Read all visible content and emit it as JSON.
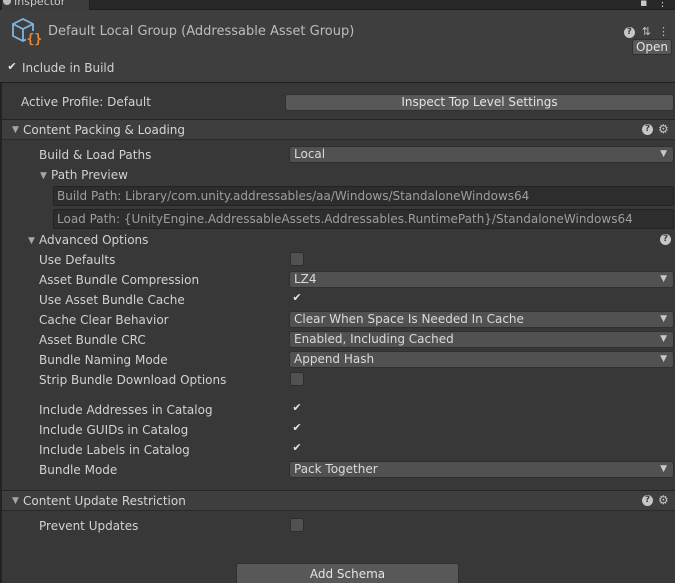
{
  "tab": {
    "label": "Inspector"
  },
  "header": {
    "title": "Default Local Group (Addressable Asset Group)",
    "open_label": "Open",
    "include_in_build_label": "Include in Build",
    "include_in_build_checked": true
  },
  "active_profile": {
    "label": "Active Profile: Default",
    "inspect_button": "Inspect Top Level Settings"
  },
  "content_packing": {
    "title": "Content Packing & Loading",
    "build_load_paths_label": "Build & Load Paths",
    "build_load_paths_value": "Local",
    "path_preview_label": "Path Preview",
    "build_path": "Build Path: Library/com.unity.addressables/aa/Windows/StandaloneWindows64",
    "load_path": "Load Path: {UnityEngine.AddressableAssets.Addressables.RuntimePath}/StandaloneWindows64",
    "advanced_options_label": "Advanced Options",
    "options": [
      {
        "label": "Use Defaults",
        "kind": "checkbox",
        "checked": false
      },
      {
        "label": "Asset Bundle Compression",
        "kind": "dropdown",
        "value": "LZ4"
      },
      {
        "label": "Use Asset Bundle Cache",
        "kind": "checkbox",
        "checked": true
      },
      {
        "label": "Cache Clear Behavior",
        "kind": "dropdown",
        "value": "Clear When Space Is Needed In Cache"
      },
      {
        "label": "Asset Bundle CRC",
        "kind": "dropdown",
        "value": "Enabled, Including Cached"
      },
      {
        "label": "Bundle Naming Mode",
        "kind": "dropdown",
        "value": "Append Hash"
      },
      {
        "label": "Strip Bundle Download Options",
        "kind": "checkbox",
        "checked": false
      },
      {
        "label": "Include Addresses in Catalog",
        "kind": "checkbox",
        "checked": true
      },
      {
        "label": "Include GUIDs in Catalog",
        "kind": "checkbox",
        "checked": true
      },
      {
        "label": "Include Labels in Catalog",
        "kind": "checkbox",
        "checked": true
      },
      {
        "label": "Bundle Mode",
        "kind": "dropdown",
        "value": "Pack Together"
      }
    ]
  },
  "content_update": {
    "title": "Content Update Restriction",
    "prevent_updates_label": "Prevent Updates",
    "prevent_updates_checked": false
  },
  "add_schema_label": "Add Schema",
  "icons": {
    "help": "help-icon",
    "settings": "gear-icon",
    "presets": "sliders-icon",
    "menu": "kebab-menu-icon",
    "asset": "addressable-group-icon",
    "foldout_open": "triangle-down-icon"
  }
}
